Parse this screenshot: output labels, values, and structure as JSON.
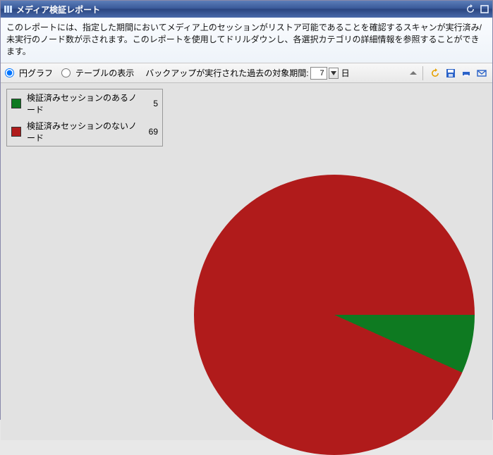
{
  "header": {
    "title": "メディア検証レポート"
  },
  "description": "このレポートには、指定した期間においてメディア上のセッションがリストア可能であることを確認するスキャンが実行済み/未実行のノード数が示されます。このレポートを使用してドリルダウンし、各選択カテゴリの詳細情報を参照することができます。",
  "toolbar": {
    "view_pie_label": "円グラフ",
    "view_table_label": "テーブルの表示",
    "period_label": "バックアップが実行された過去の対象期間:",
    "period_value": "7",
    "period_unit": "日"
  },
  "legend": {
    "items": [
      {
        "label": "検証済みセッションのあるノード",
        "value": "5",
        "color": "#0e7a21"
      },
      {
        "label": "検証済みセッションのないノード",
        "value": "69",
        "color": "#b01b1b"
      }
    ]
  },
  "chart_data": {
    "type": "pie",
    "title": "メディア検証レポート",
    "series": [
      {
        "name": "検証済みセッションのあるノード",
        "value": 5,
        "color": "#0e7a21"
      },
      {
        "name": "検証済みセッションのないノード",
        "value": 69,
        "color": "#b01b1b"
      }
    ]
  }
}
